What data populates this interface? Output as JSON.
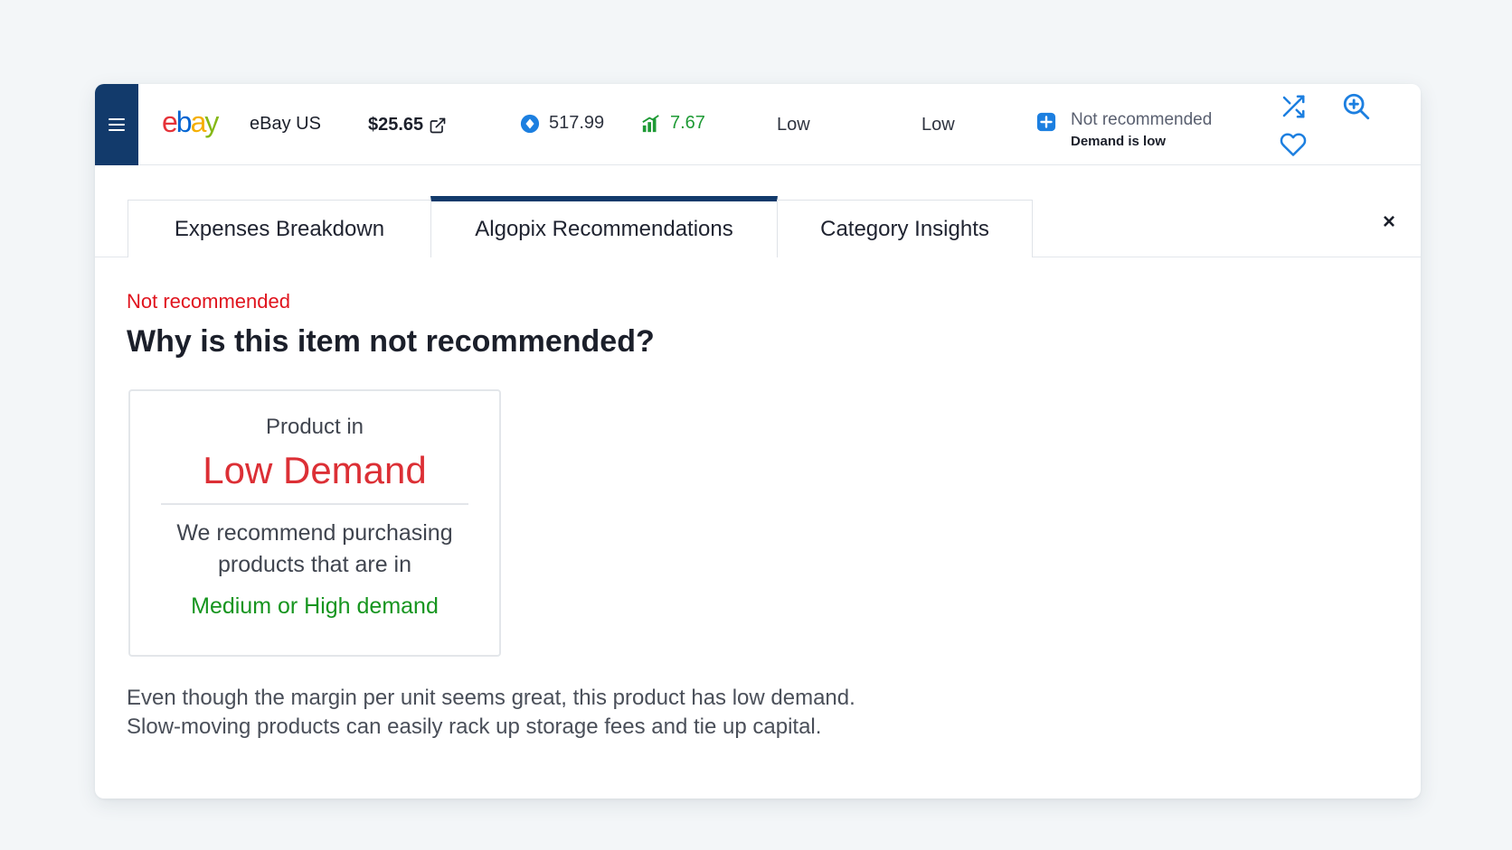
{
  "header": {
    "marketplace": "eBay US",
    "logo_letters": [
      "e",
      "b",
      "a",
      "y"
    ],
    "price": "$25.65",
    "bsr_value": "517.99",
    "roi_value": "7.67",
    "metric_one": "Low",
    "metric_two": "Low",
    "recommendation_status": "Not recommended",
    "recommendation_reason": "Demand is low",
    "icons": [
      "menu-icon",
      "external-link-icon",
      "circle-dot-icon",
      "bar-chart-icon",
      "plus-square-icon",
      "shuffle-icon",
      "zoom-in-icon",
      "heart-icon",
      "close-icon"
    ],
    "colors": {
      "brand": "#123a6b",
      "accent_blue": "#1c7fe0",
      "green": "#1e9a35",
      "red": "#e0141e"
    }
  },
  "tabs": [
    {
      "label": "Expenses Breakdown",
      "active": false
    },
    {
      "label": "Algopix Recommendations",
      "active": true
    },
    {
      "label": "Category Insights",
      "active": false
    }
  ],
  "close_label": "×",
  "content": {
    "status_label": "Not recommended",
    "headline": "Why is this item not recommended?",
    "demand_box": {
      "pre": "Product in",
      "level": "Low Demand",
      "advice": "We recommend purchasing products that are in",
      "target": "Medium or High demand"
    },
    "explanation": "Even though the margin per unit seems great, this product has low demand. Slow-moving products can easily rack up storage fees and tie up capital."
  }
}
